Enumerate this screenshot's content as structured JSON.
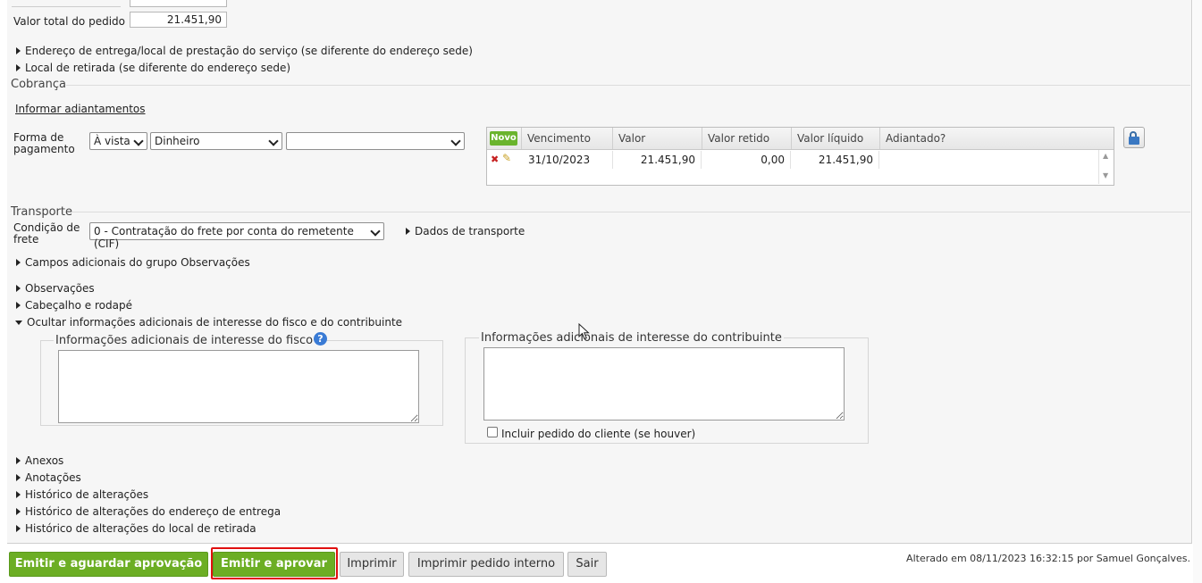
{
  "order": {
    "total_label": "Valor total do pedido",
    "total_value": "21.451,90"
  },
  "links": {
    "delivery_address": "Endereço de entrega/local de prestação do serviço (se diferente do endereço sede)",
    "pickup_location": "Local de retirada (se diferente do endereço sede)"
  },
  "cobranca": {
    "title": "Cobrança",
    "advances_link": "Informar adiantamentos",
    "payment_label_line1": "Forma de",
    "payment_label_line2": "pagamento",
    "term_select": "À vista",
    "method_select": "Dinheiro",
    "extra_select": ""
  },
  "installments": {
    "new_button": "Novo",
    "headers": [
      "Vencimento",
      "Valor",
      "Valor retido",
      "Valor líquido",
      "Adiantado?"
    ],
    "rows": [
      {
        "vencimento": "31/10/2023",
        "valor": "21.451,90",
        "valor_retido": "0,00",
        "valor_liquido": "21.451,90",
        "adiantado": ""
      }
    ]
  },
  "transporte": {
    "title": "Transporte",
    "freight_label_line1": "Condição de",
    "freight_label_line2": "frete",
    "freight_select": "0 - Contratação do frete por conta do remetente (CIF)",
    "transport_data": "Dados de transporte"
  },
  "collapsibles": {
    "extra_fields": "Campos adicionais do grupo Observações",
    "observacoes": "Observações",
    "header_footer": "Cabeçalho e rodapé",
    "hide_additional": "Ocultar informações adicionais de interesse do fisco e do contribuinte"
  },
  "additional_info": {
    "fisco_title": "Informações adicionais de interesse do fisco",
    "contribuinte_title": "Informações adicionais de interesse do contribuinte",
    "include_order_label": "Incluir pedido do cliente (se houver)"
  },
  "bottom_links": [
    "Anexos",
    "Anotações",
    "Histórico de alterações",
    "Histórico de alterações do endereço de entrega",
    "Histórico de alterações do local de retirada"
  ],
  "footer": {
    "emit_wait": "Emitir e aguardar aprovação",
    "emit_approve": "Emitir e aprovar",
    "print": "Imprimir",
    "print_internal": "Imprimir pedido interno",
    "exit": "Sair",
    "status": "Alterado em 08/11/2023 16:32:15 por Samuel Gonçalves."
  },
  "colors": {
    "green": "#6cae24",
    "highlight": "#e01010"
  }
}
